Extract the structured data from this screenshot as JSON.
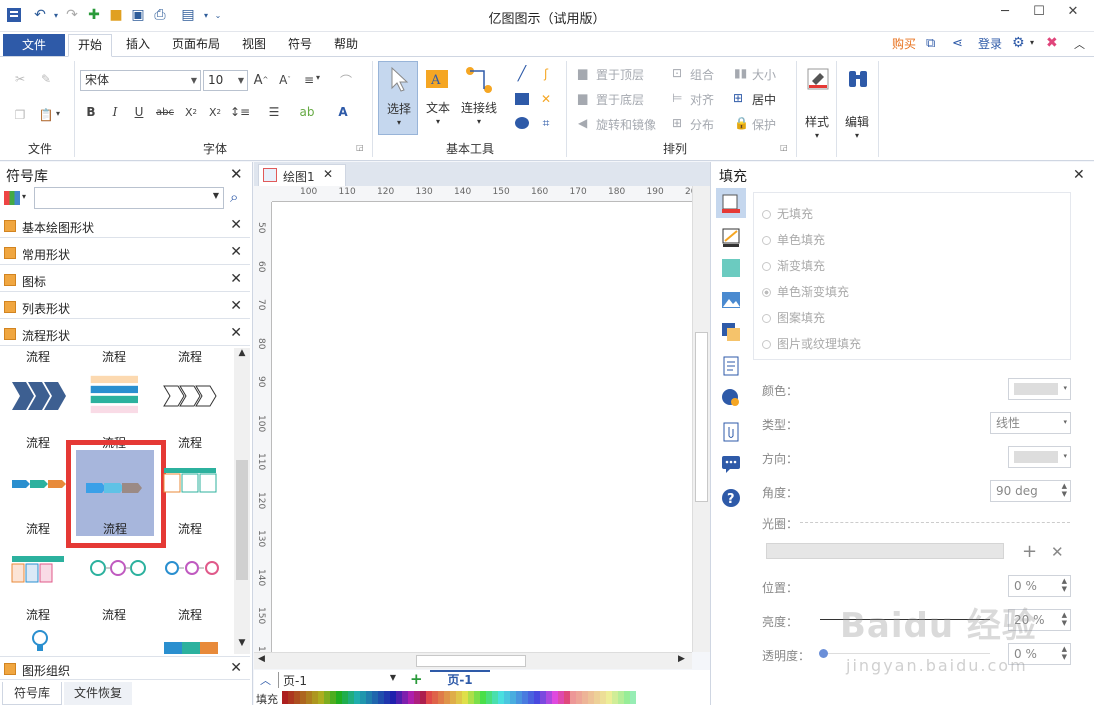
{
  "window": {
    "title": "亿图图示（试用版）",
    "buttons": [
      "─",
      "☐",
      "✕"
    ]
  },
  "menu": {
    "file": "文件",
    "tabs": [
      "开始",
      "插入",
      "页面布局",
      "视图",
      "符号",
      "帮助"
    ],
    "right": {
      "buy": "购买",
      "login": "登录"
    }
  },
  "ribbon": {
    "groups": {
      "file": "文件",
      "font": "字体",
      "basic_tools": "基本工具",
      "arrange": "排列"
    },
    "font": {
      "family": "宋体",
      "size": "10"
    },
    "tools": {
      "select": "选择",
      "text": "文本",
      "connector": "连接线"
    },
    "arrange": {
      "bring_front": "置于顶层",
      "send_back": "置于底层",
      "rotate_mirror": "旋转和镜像",
      "group": "组合",
      "align": "对齐",
      "distribute": "分布",
      "size": "大小",
      "center": "居中",
      "protect": "保护"
    },
    "style": "样式",
    "edit": "编辑"
  },
  "library": {
    "title": "符号库",
    "search_placeholder": "",
    "categories": [
      "基本绘图形状",
      "常用形状",
      "图标",
      "列表形状",
      "流程形状"
    ],
    "shape_label": "流程",
    "bottom_header": "图形组织",
    "bottom_tabs": [
      "符号库",
      "文件恢复"
    ]
  },
  "document": {
    "tab": "绘图1",
    "hruler": [
      "100",
      "110",
      "120",
      "130",
      "140",
      "150",
      "160",
      "170",
      "180",
      "190",
      "200"
    ],
    "vruler": [
      "50",
      "60",
      "70",
      "80",
      "90",
      "100",
      "110",
      "120",
      "130",
      "140",
      "150",
      "160"
    ],
    "page_select": "页-1",
    "page_tab": "页-1",
    "fill_label": "填充"
  },
  "fill_panel": {
    "title": "填充",
    "options": [
      "无填充",
      "单色填充",
      "渐变填充",
      "单色渐变填充",
      "图案填充",
      "图片或纹理填充"
    ],
    "selected_option": "单色渐变填充",
    "labels": {
      "color": "颜色：",
      "type": "类型：",
      "direction": "方向：",
      "angle": "角度：",
      "aperture": "光圈：",
      "position": "位置：",
      "brightness": "亮度：",
      "transparency": "透明度："
    },
    "type_value": "线性",
    "angle_value": "90 deg",
    "position_value": "0 %",
    "brightness_value": "20 %",
    "transparency_value": "0 %"
  },
  "watermark": {
    "brand": "Baidu 经验",
    "url": "jingyan.baidu.com"
  },
  "colors": {
    "accent": "#2e5aa8",
    "highlight": "#e53935",
    "buy": "#e8711c"
  }
}
